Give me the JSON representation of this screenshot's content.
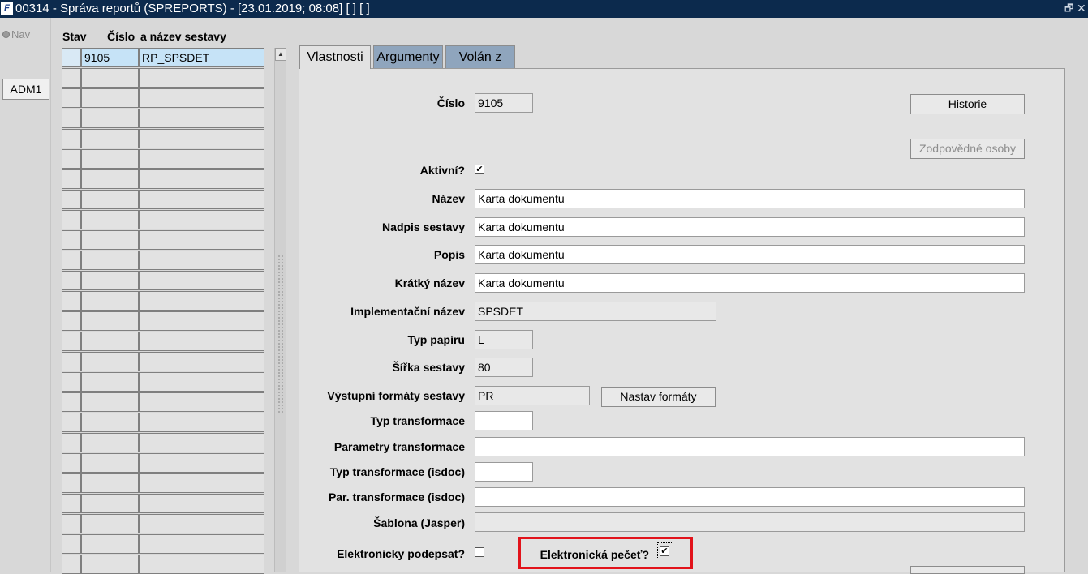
{
  "window": {
    "title": "00314 - Správa reportů (SPREPORTS) - [23.01.2019; 08:08]  [ ]  [ ]",
    "app_icon": "form-app-icon",
    "restore_glyph": "🗗",
    "close_glyph": "✕"
  },
  "nav": {
    "radio_label": "Nav",
    "adm_button": "ADM1"
  },
  "table": {
    "headers": [
      "Stav",
      "Číslo",
      "a název sestavy"
    ],
    "rows": [
      {
        "stav": "",
        "cislo": "9105",
        "nazev": "RP_SPSDET",
        "selected": true
      },
      {
        "stav": "",
        "cislo": "",
        "nazev": ""
      },
      {
        "stav": "",
        "cislo": "",
        "nazev": ""
      },
      {
        "stav": "",
        "cislo": "",
        "nazev": ""
      },
      {
        "stav": "",
        "cislo": "",
        "nazev": ""
      },
      {
        "stav": "",
        "cislo": "",
        "nazev": ""
      },
      {
        "stav": "",
        "cislo": "",
        "nazev": ""
      },
      {
        "stav": "",
        "cislo": "",
        "nazev": ""
      },
      {
        "stav": "",
        "cislo": "",
        "nazev": ""
      },
      {
        "stav": "",
        "cislo": "",
        "nazev": ""
      },
      {
        "stav": "",
        "cislo": "",
        "nazev": ""
      },
      {
        "stav": "",
        "cislo": "",
        "nazev": ""
      },
      {
        "stav": "",
        "cislo": "",
        "nazev": ""
      },
      {
        "stav": "",
        "cislo": "",
        "nazev": ""
      },
      {
        "stav": "",
        "cislo": "",
        "nazev": ""
      },
      {
        "stav": "",
        "cislo": "",
        "nazev": ""
      },
      {
        "stav": "",
        "cislo": "",
        "nazev": ""
      },
      {
        "stav": "",
        "cislo": "",
        "nazev": ""
      },
      {
        "stav": "",
        "cislo": "",
        "nazev": ""
      },
      {
        "stav": "",
        "cislo": "",
        "nazev": ""
      },
      {
        "stav": "",
        "cislo": "",
        "nazev": ""
      },
      {
        "stav": "",
        "cislo": "",
        "nazev": ""
      },
      {
        "stav": "",
        "cislo": "",
        "nazev": ""
      },
      {
        "stav": "",
        "cislo": "",
        "nazev": ""
      },
      {
        "stav": "",
        "cislo": "",
        "nazev": ""
      },
      {
        "stav": "",
        "cislo": "",
        "nazev": ""
      }
    ]
  },
  "tabs": [
    {
      "label": "Vlastnosti",
      "active": true
    },
    {
      "label": "Argumenty",
      "active": false
    },
    {
      "label": "Volán z",
      "active": false
    }
  ],
  "form": {
    "cislo": {
      "label": "Číslo",
      "value": "9105"
    },
    "historie_button": "Historie",
    "zodpovedne_button": "Zodpovědné osoby",
    "aktivni": {
      "label": "Aktivní?",
      "checked": true
    },
    "nazev": {
      "label": "Název",
      "value": "Karta dokumentu"
    },
    "nadpis": {
      "label": "Nadpis sestavy",
      "value": "Karta dokumentu"
    },
    "popis": {
      "label": "Popis",
      "value": "Karta dokumentu"
    },
    "kratky": {
      "label": "Krátký název",
      "value": "Karta dokumentu"
    },
    "implementacni": {
      "label": "Implementační název",
      "value": "SPSDET"
    },
    "typ_papiru": {
      "label": "Typ papíru",
      "value": "L"
    },
    "sirka": {
      "label": "Šířka sestavy",
      "value": "80"
    },
    "vystupni": {
      "label": "Výstupní formáty sestavy",
      "value": "PR"
    },
    "nastav_button": "Nastav formáty",
    "typ_transformace": {
      "label": "Typ transformace",
      "value": ""
    },
    "parametry_transformace": {
      "label": "Parametry transformace",
      "value": ""
    },
    "typ_transformace_isdoc": {
      "label": "Typ transformace (isdoc)",
      "value": ""
    },
    "par_transformace_isdoc": {
      "label": "Par. transformace (isdoc)",
      "value": ""
    },
    "sablona": {
      "label": "Šablona (Jasper)",
      "value": ""
    },
    "podepsat": {
      "label": "Elektronicky podepsat?",
      "checked": false
    },
    "pecet": {
      "label": "Elektronická pečeť?",
      "checked": true
    }
  },
  "glyphs": {
    "check": "✔",
    "unchecked": "",
    "scroll_up": "▲"
  },
  "colors": {
    "titlebar": "#0c2a4d",
    "highlight_border": "#e2131b",
    "selected_row": "#c6e3f7",
    "inactive_tab": "#8fa5bd"
  }
}
